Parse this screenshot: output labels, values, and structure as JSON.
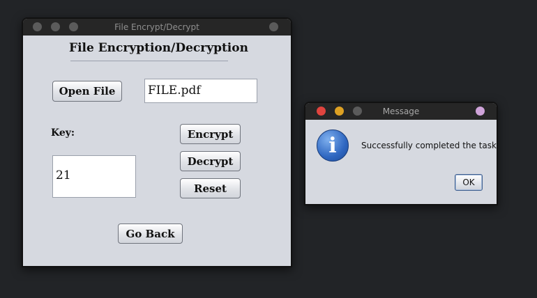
{
  "main_window": {
    "title": "File Encrypt/Decrypt",
    "heading": "File Encryption/Decryption",
    "open_file_label": "Open File",
    "file_name_value": "FILE.pdf",
    "key_label": "Key:",
    "key_value": "21",
    "encrypt_label": "Encrypt",
    "decrypt_label": "Decrypt",
    "reset_label": "Reset",
    "go_back_label": "Go Back"
  },
  "dialog": {
    "title": "Message",
    "message": "Successfully completed the task",
    "ok_label": "OK",
    "icon": "info-icon"
  },
  "colors": {
    "window_bg": "#d6d9e0",
    "titlebar_bg": "#262626",
    "close": "#e0443e",
    "minimize": "#dea123",
    "zoom": "#5b5b5b",
    "extra_dot": "#cfa3d9"
  }
}
